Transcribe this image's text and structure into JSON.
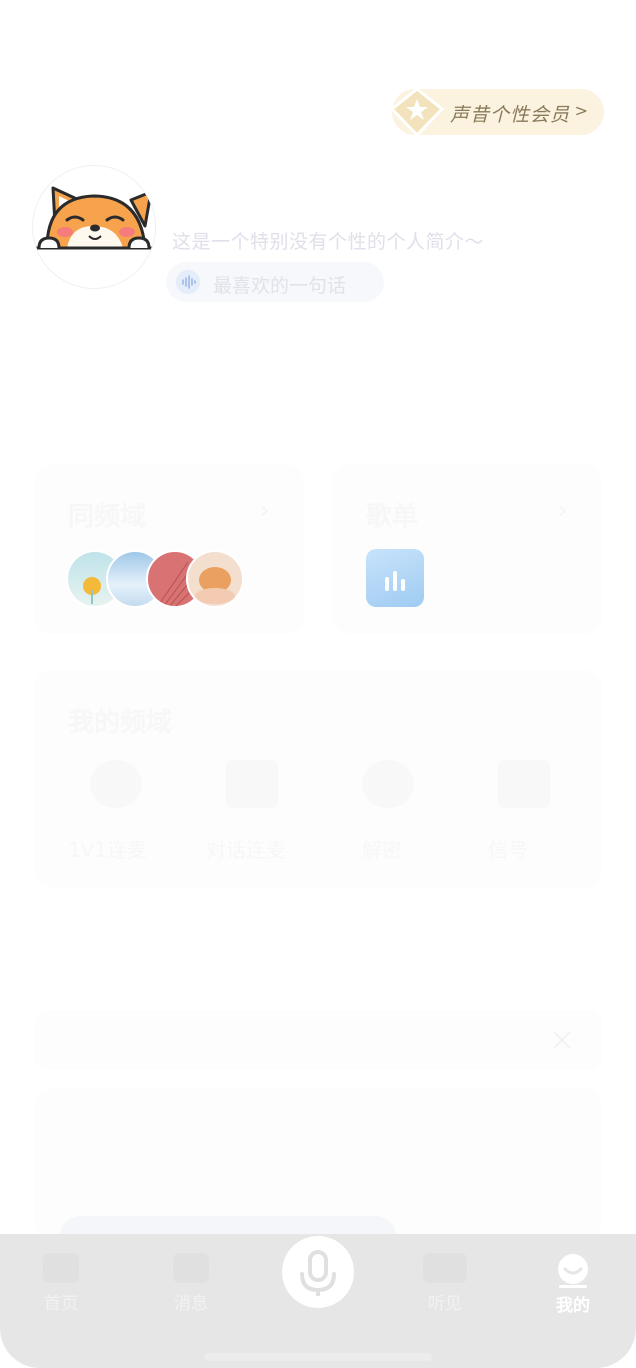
{
  "vip": {
    "label": "声昔个性会员",
    "chevron": ">"
  },
  "profile": {
    "bio": "这是一个特别没有个性的个人简介～",
    "favorite_quote": "最喜欢的一句话"
  },
  "cards": {
    "similar": {
      "title": "同频域",
      "chevron": "›"
    },
    "playlist": {
      "title": "歌单",
      "chevron": "›"
    },
    "tools": {
      "title": "我的频域",
      "items": [
        {
          "label": "1V1连麦",
          "icon": "headset-icon"
        },
        {
          "label": "对话连麦",
          "icon": "chat-icon"
        },
        {
          "label": "解密",
          "icon": "key-icon"
        },
        {
          "label": "信号",
          "icon": "mail-icon"
        }
      ]
    }
  },
  "tabs": [
    {
      "label": "首页",
      "icon": "home-icon"
    },
    {
      "label": "消息",
      "icon": "message-icon"
    },
    {
      "label": "",
      "icon": "microphone-icon"
    },
    {
      "label": "听见",
      "icon": "listen-icon"
    },
    {
      "label": "我的",
      "icon": "profile-icon"
    }
  ],
  "colors": {
    "vip_bg": "#fbf3df",
    "vip_text": "#8a7a5a",
    "tabbar_bg": "#e6e6e6"
  }
}
